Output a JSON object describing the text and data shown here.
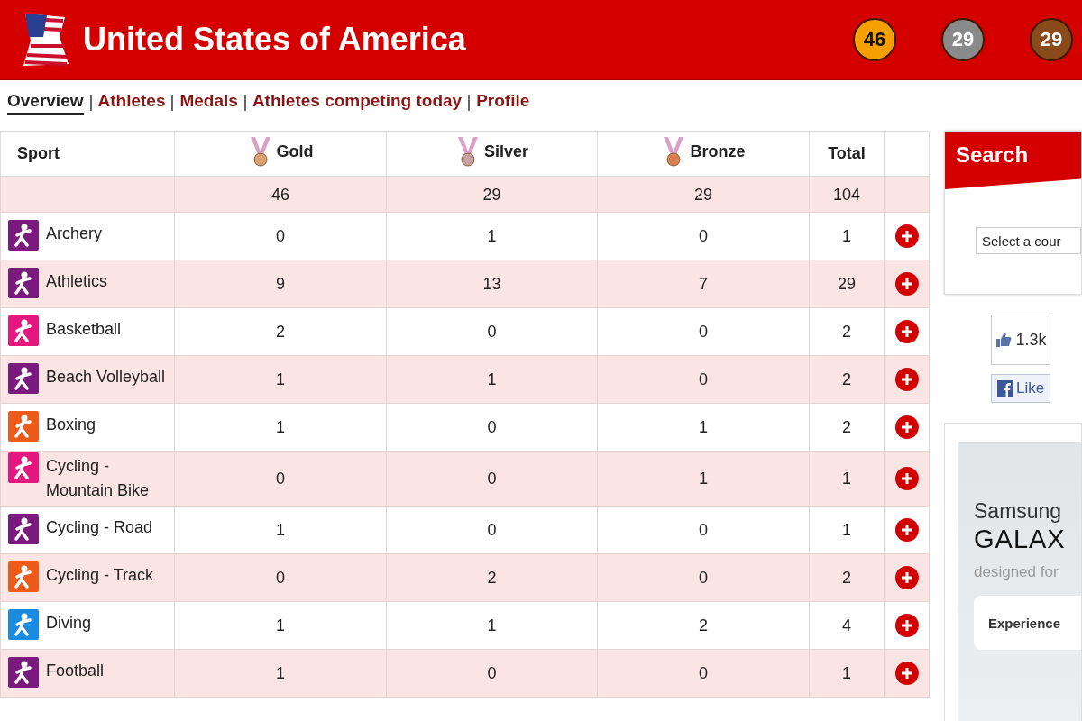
{
  "header": {
    "title": "United States of America",
    "medals": [
      {
        "kind": "gold",
        "count": "46"
      },
      {
        "kind": "silver",
        "count": "29"
      },
      {
        "kind": "bronze",
        "count": "29"
      }
    ]
  },
  "nav": [
    {
      "label": "Overview",
      "selected": true
    },
    {
      "label": "Athletes",
      "selected": false
    },
    {
      "label": "Medals",
      "selected": false
    },
    {
      "label": "Athletes competing today",
      "selected": false
    },
    {
      "label": "Profile",
      "selected": false
    }
  ],
  "table": {
    "columns": [
      {
        "label": "Sport"
      },
      {
        "label": "Gold",
        "color": "#d9a070"
      },
      {
        "label": "Silver",
        "color": "#c8a0a0"
      },
      {
        "label": "Bronze",
        "color": "#d98050"
      },
      {
        "label": "Total"
      }
    ],
    "totals": [
      "46",
      "29",
      "29",
      "104"
    ],
    "rows": [
      {
        "sport": "Archery",
        "color": "#7b1a7e",
        "gold": "0",
        "silver": "1",
        "bronze": "0",
        "total": "1"
      },
      {
        "sport": "Athletics",
        "color": "#7b1a7e",
        "gold": "9",
        "silver": "13",
        "bronze": "7",
        "total": "29"
      },
      {
        "sport": "Basketball",
        "color": "#e5177e",
        "gold": "2",
        "silver": "0",
        "bronze": "0",
        "total": "2"
      },
      {
        "sport": "Beach Volleyball",
        "color": "#7b1a7e",
        "gold": "1",
        "silver": "1",
        "bronze": "0",
        "total": "2"
      },
      {
        "sport": "Boxing",
        "color": "#ee5a1a",
        "gold": "1",
        "silver": "0",
        "bronze": "1",
        "total": "2"
      },
      {
        "sport": "Cycling - Mountain Bike",
        "color": "#e5177e",
        "gold": "0",
        "silver": "0",
        "bronze": "1",
        "total": "1"
      },
      {
        "sport": "Cycling - Road",
        "color": "#7b1a7e",
        "gold": "1",
        "silver": "0",
        "bronze": "0",
        "total": "1"
      },
      {
        "sport": "Cycling - Track",
        "color": "#ee5a1a",
        "gold": "0",
        "silver": "2",
        "bronze": "0",
        "total": "2"
      },
      {
        "sport": "Diving",
        "color": "#1a8be0",
        "gold": "1",
        "silver": "1",
        "bronze": "2",
        "total": "4"
      },
      {
        "sport": "Football",
        "color": "#7b1a7e",
        "gold": "1",
        "silver": "0",
        "bronze": "0",
        "total": "1"
      }
    ]
  },
  "sidebar": {
    "search": {
      "title": "Search",
      "placeholder": "Select a cour"
    },
    "like": {
      "count": "1.3k",
      "button": "Like"
    },
    "ad": {
      "brand": "Samsung",
      "product": "GALAX",
      "tagline": "designed for",
      "button": "Experience"
    }
  }
}
